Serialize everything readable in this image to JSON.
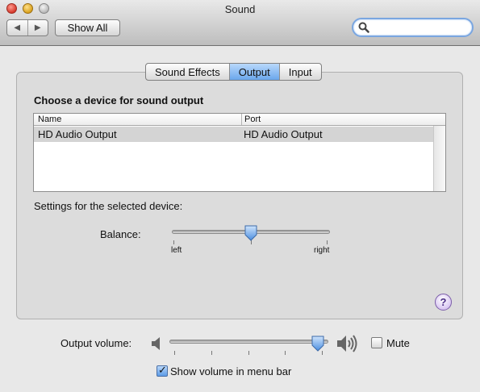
{
  "window": {
    "title": "Sound"
  },
  "toolbar": {
    "back_icon": "left-arrow-icon",
    "forward_icon": "right-arrow-icon",
    "show_all_label": "Show All",
    "search_placeholder": ""
  },
  "tabs": [
    {
      "label": "Sound Effects",
      "selected": false
    },
    {
      "label": "Output",
      "selected": true
    },
    {
      "label": "Input",
      "selected": false
    }
  ],
  "output": {
    "heading": "Choose a device for sound output",
    "columns": [
      "Name",
      "Port"
    ],
    "rows": [
      {
        "name": "HD Audio Output",
        "port": "HD Audio Output",
        "selected": true
      }
    ],
    "settings_label": "Settings for the selected device:",
    "balance": {
      "label": "Balance:",
      "left_label": "left",
      "right_label": "right",
      "value": 0.5
    }
  },
  "footer": {
    "output_volume_label": "Output volume:",
    "output_volume_value": 0.98,
    "mute_label": "Mute",
    "mute_checked": false,
    "menubar_label": "Show volume in menu bar",
    "menubar_checked": true
  },
  "colors": {
    "accent": "#6aa7ec",
    "selection_row": "#d4d4d4"
  }
}
